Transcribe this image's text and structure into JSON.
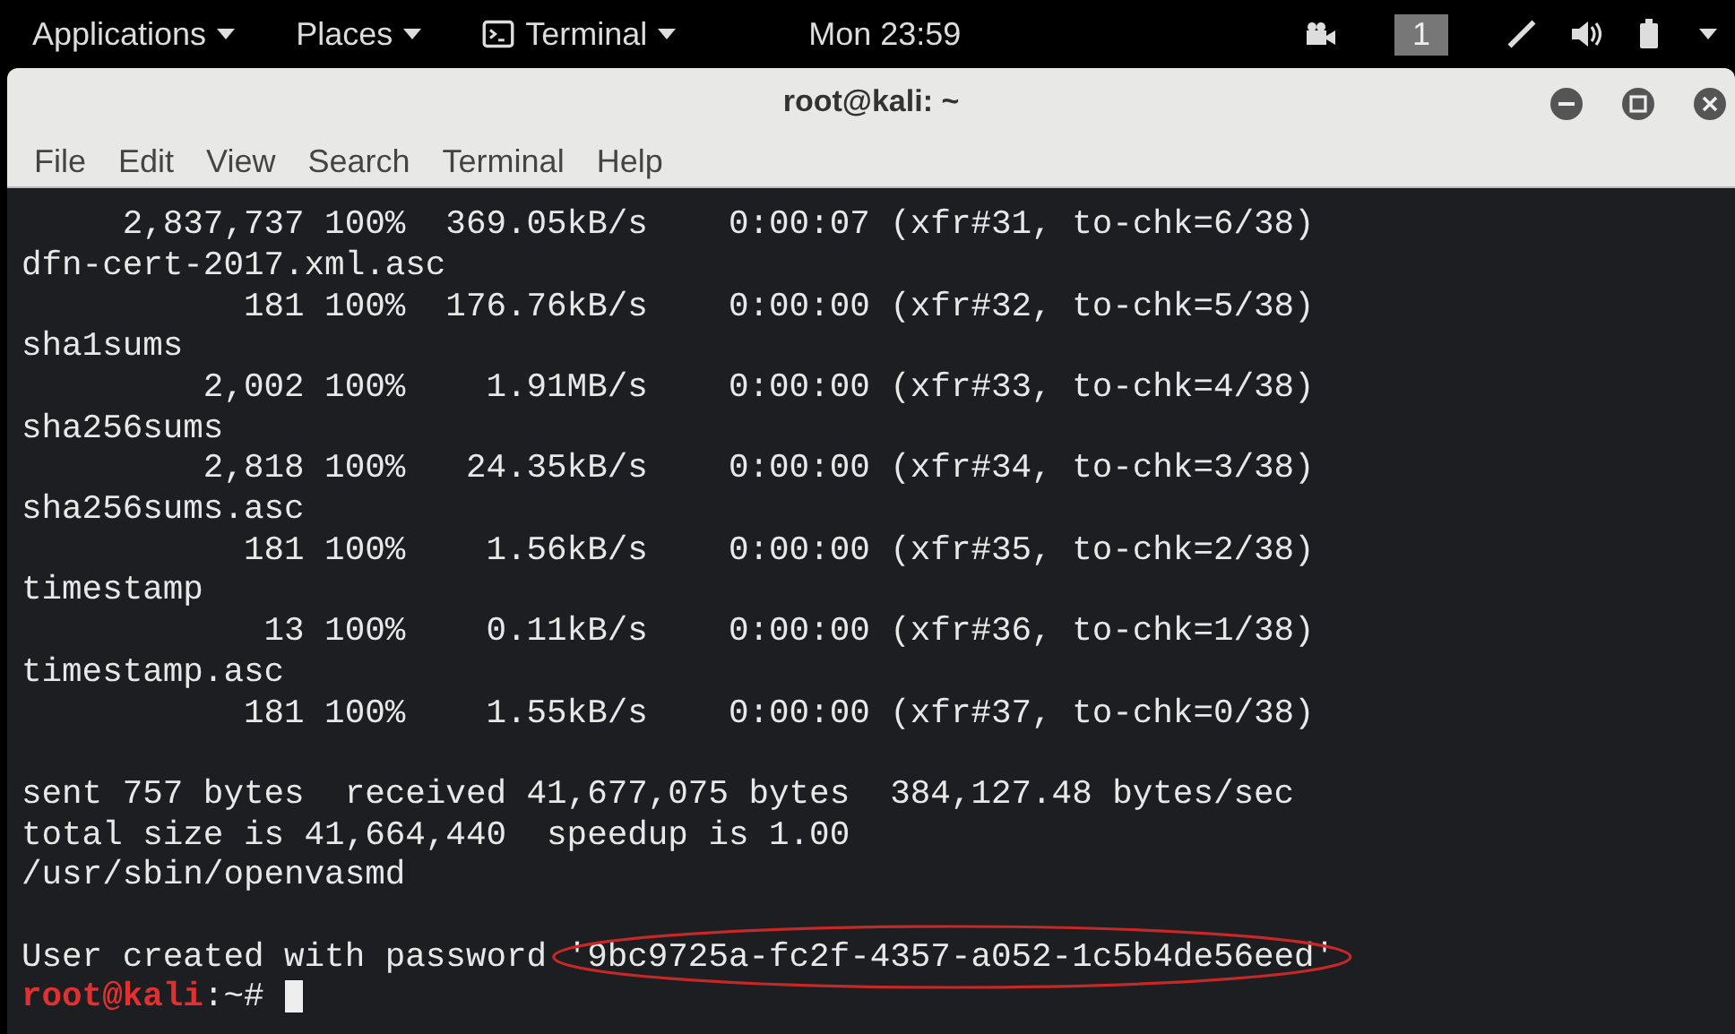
{
  "top_bar": {
    "menus": [
      {
        "label": "Applications"
      },
      {
        "label": "Places"
      },
      {
        "label": "Terminal"
      }
    ],
    "clock": "Mon 23:59",
    "workspace": "1"
  },
  "window": {
    "title": "root@kali: ~"
  },
  "menu_bar": [
    "File",
    "Edit",
    "View",
    "Search",
    "Terminal",
    "Help"
  ],
  "terminal": {
    "lines": [
      {
        "kind": "text",
        "text": "     2,837,737 100%  369.05kB/s    0:00:07 (xfr#31, to-chk=6/38)"
      },
      {
        "kind": "text",
        "text": "dfn-cert-2017.xml.asc"
      },
      {
        "kind": "text",
        "text": "           181 100%  176.76kB/s    0:00:00 (xfr#32, to-chk=5/38)"
      },
      {
        "kind": "text",
        "text": "sha1sums"
      },
      {
        "kind": "text",
        "text": "         2,002 100%    1.91MB/s    0:00:00 (xfr#33, to-chk=4/38)"
      },
      {
        "kind": "text",
        "text": "sha256sums"
      },
      {
        "kind": "text",
        "text": "         2,818 100%   24.35kB/s    0:00:00 (xfr#34, to-chk=3/38)"
      },
      {
        "kind": "text",
        "text": "sha256sums.asc"
      },
      {
        "kind": "text",
        "text": "           181 100%    1.56kB/s    0:00:00 (xfr#35, to-chk=2/38)"
      },
      {
        "kind": "text",
        "text": "timestamp"
      },
      {
        "kind": "text",
        "text": "            13 100%    0.11kB/s    0:00:00 (xfr#36, to-chk=1/38)"
      },
      {
        "kind": "text",
        "text": "timestamp.asc"
      },
      {
        "kind": "text",
        "text": "           181 100%    1.55kB/s    0:00:00 (xfr#37, to-chk=0/38)"
      },
      {
        "kind": "blank"
      },
      {
        "kind": "text",
        "text": "sent 757 bytes  received 41,677,075 bytes  384,127.48 bytes/sec"
      },
      {
        "kind": "text",
        "text": "total size is 41,664,440  speedup is 1.00"
      },
      {
        "kind": "text",
        "text": "/usr/sbin/openvasmd"
      },
      {
        "kind": "blank"
      },
      {
        "kind": "password",
        "text": "User created with password ",
        "value": "'9bc9725a-fc2f-4357-a052-1c5b4de56eed'"
      },
      {
        "kind": "prompt",
        "user": "root@kali",
        "path": ":~#"
      }
    ]
  }
}
